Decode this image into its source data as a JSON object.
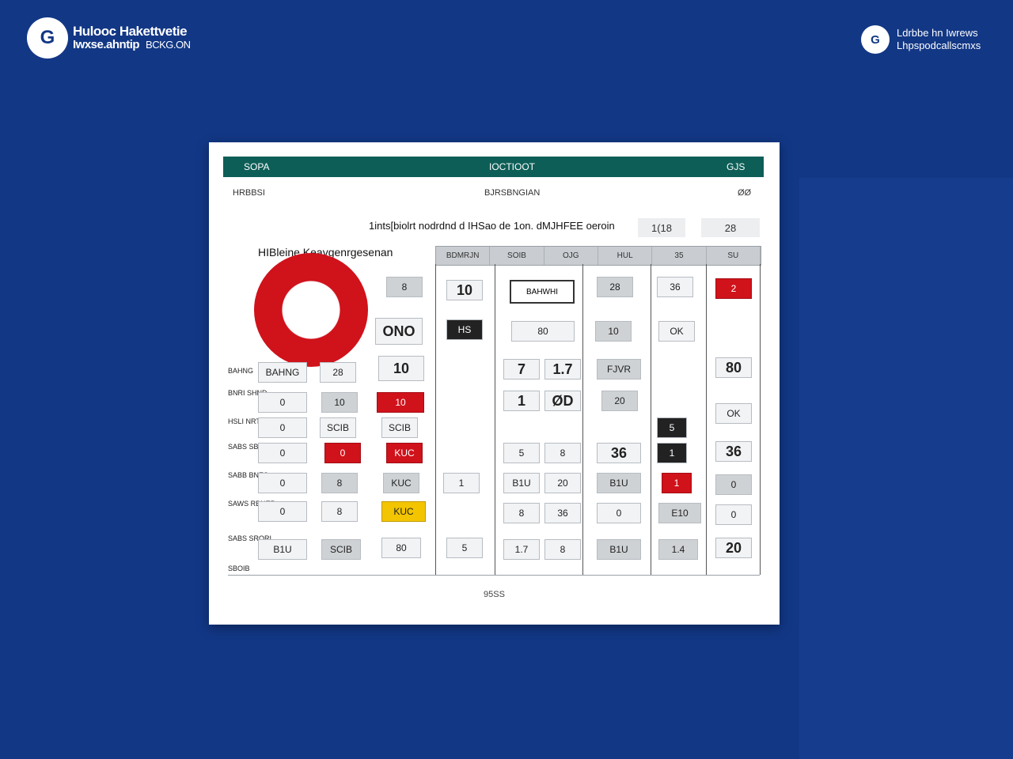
{
  "brand_left": {
    "icon": "G",
    "line1": "Hulooc Hakettvetie",
    "line2": "Iwxse.ahntip",
    "line2_light": "BCKG.ON"
  },
  "brand_right": {
    "icon": "G",
    "line1": "Ldrbbe hn Iwrews",
    "line2": "Lhpspodcallscmxs"
  },
  "card": {
    "bar": {
      "left": "SOPA",
      "center": "IOCTIOOT",
      "right": "GJS"
    },
    "sub": {
      "left": "HRBBSI",
      "center": "BJRSBNGIAN",
      "right": "ØØ"
    },
    "question": "1ints[biolrt nodrdnd d IHSao de 1on. dMJHFEE oeroin",
    "chips": [
      "1(18",
      "28"
    ],
    "label": "HIBleine Keavgenrgesenan",
    "columns": [
      "BDMRJN",
      "SOIB",
      "OJG",
      "HUL",
      "35",
      "SU"
    ],
    "tag": "BAHWHI",
    "rows": [
      "BAHNG",
      "BNRI SHND",
      "HSLI NRTAR",
      "SABS SBNES",
      "SABB BNES",
      "SAWS RBNER",
      "SABS SRORI",
      "SBOIB"
    ],
    "cells": [
      "10",
      "ONO",
      "10",
      "10",
      "8",
      "28",
      "SCIB",
      "0",
      "HS",
      "KUC",
      "7",
      "1.7",
      "FJVR",
      "80",
      "36",
      "OK",
      "1",
      "ØD",
      "2",
      "5",
      "8",
      "36",
      "20",
      "1.4",
      "B1U",
      "E10"
    ],
    "footer": "95SS"
  }
}
